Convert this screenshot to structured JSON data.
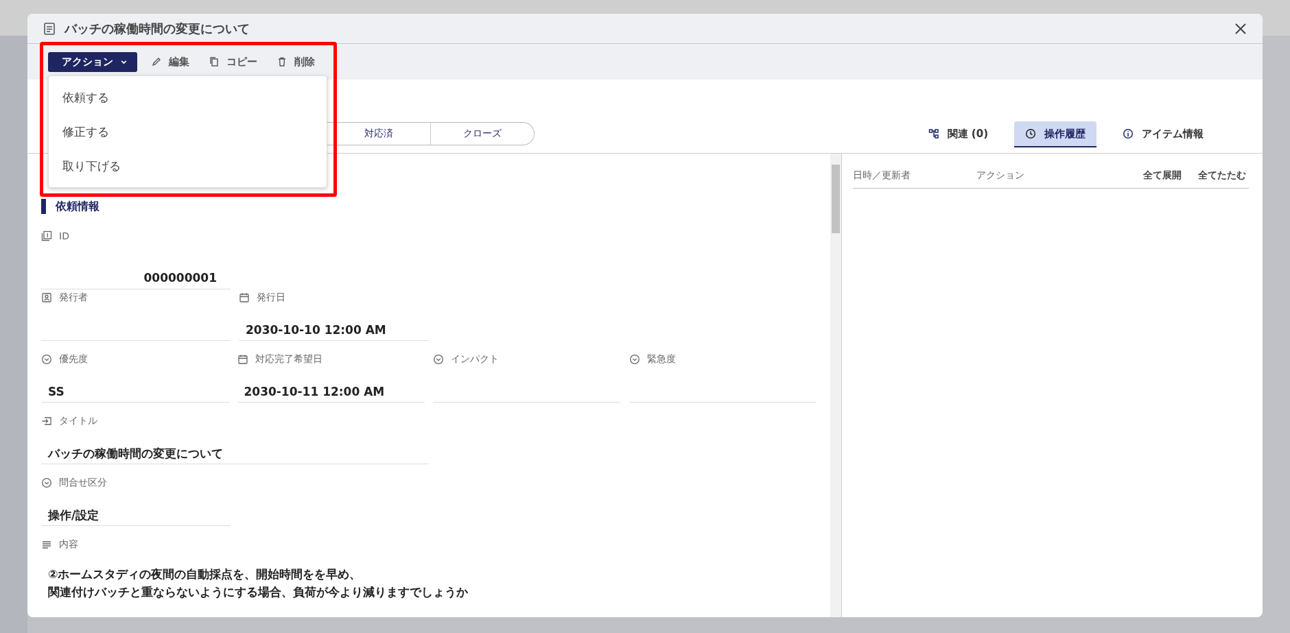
{
  "window": {
    "title": "バッチの稼働時間の変更について"
  },
  "toolbar": {
    "action_menu": {
      "label": "アクション",
      "expanded": true,
      "items": [
        {
          "label": "依頼する"
        },
        {
          "label": "修正する"
        },
        {
          "label": "取り下げる"
        }
      ]
    },
    "buttons": [
      {
        "label": "編集",
        "kind": "edit"
      },
      {
        "label": "コピー",
        "kind": "copy"
      },
      {
        "label": "削除",
        "kind": "delete"
      }
    ]
  },
  "status_steps": [
    {
      "label": "対応済"
    },
    {
      "label": "クローズ"
    }
  ],
  "panel_tabs": [
    {
      "label": "関連 (0)",
      "kind": "relations",
      "selected": false
    },
    {
      "label": "操作履歴",
      "kind": "history",
      "selected": true
    },
    {
      "label": "アイテム情報",
      "kind": "info",
      "selected": false
    }
  ],
  "section_title": "依頼情報",
  "field_rows": [
    [
      {
        "label": "ID",
        "kind": "id",
        "value": "000000001"
      }
    ],
    [
      {
        "label": "発行者",
        "kind": "person"
      },
      {
        "label": "発行日",
        "kind": "date",
        "value": "2030-10-10 12:00 AM"
      }
    ],
    [
      {
        "label": "優先度",
        "kind": "select",
        "value": "SS"
      },
      {
        "label": "対応完了希望日",
        "kind": "date",
        "value": "2030-10-11 12:00 AM"
      },
      {
        "label": "インパクト",
        "kind": "select"
      },
      {
        "label": "緊急度",
        "kind": "select"
      }
    ],
    [
      {
        "label": "タイトル",
        "kind": "text",
        "value": "バッチの稼働時間の変更について"
      }
    ],
    [
      {
        "label": "問合せ区分",
        "kind": "select",
        "value": "操作/設定"
      }
    ]
  ],
  "description": {
    "label": "内容",
    "lines": [
      "②ホームスタディの夜間の自動採点を、開始時間をを早め、",
      "関連付けバッチと重ならないようにする場合、負荷が今より減りますでしょうか"
    ]
  },
  "history": {
    "columns": [
      "日時／更新者",
      "アクション"
    ],
    "actions": [
      "全て展開",
      "全てたたむ"
    ]
  }
}
